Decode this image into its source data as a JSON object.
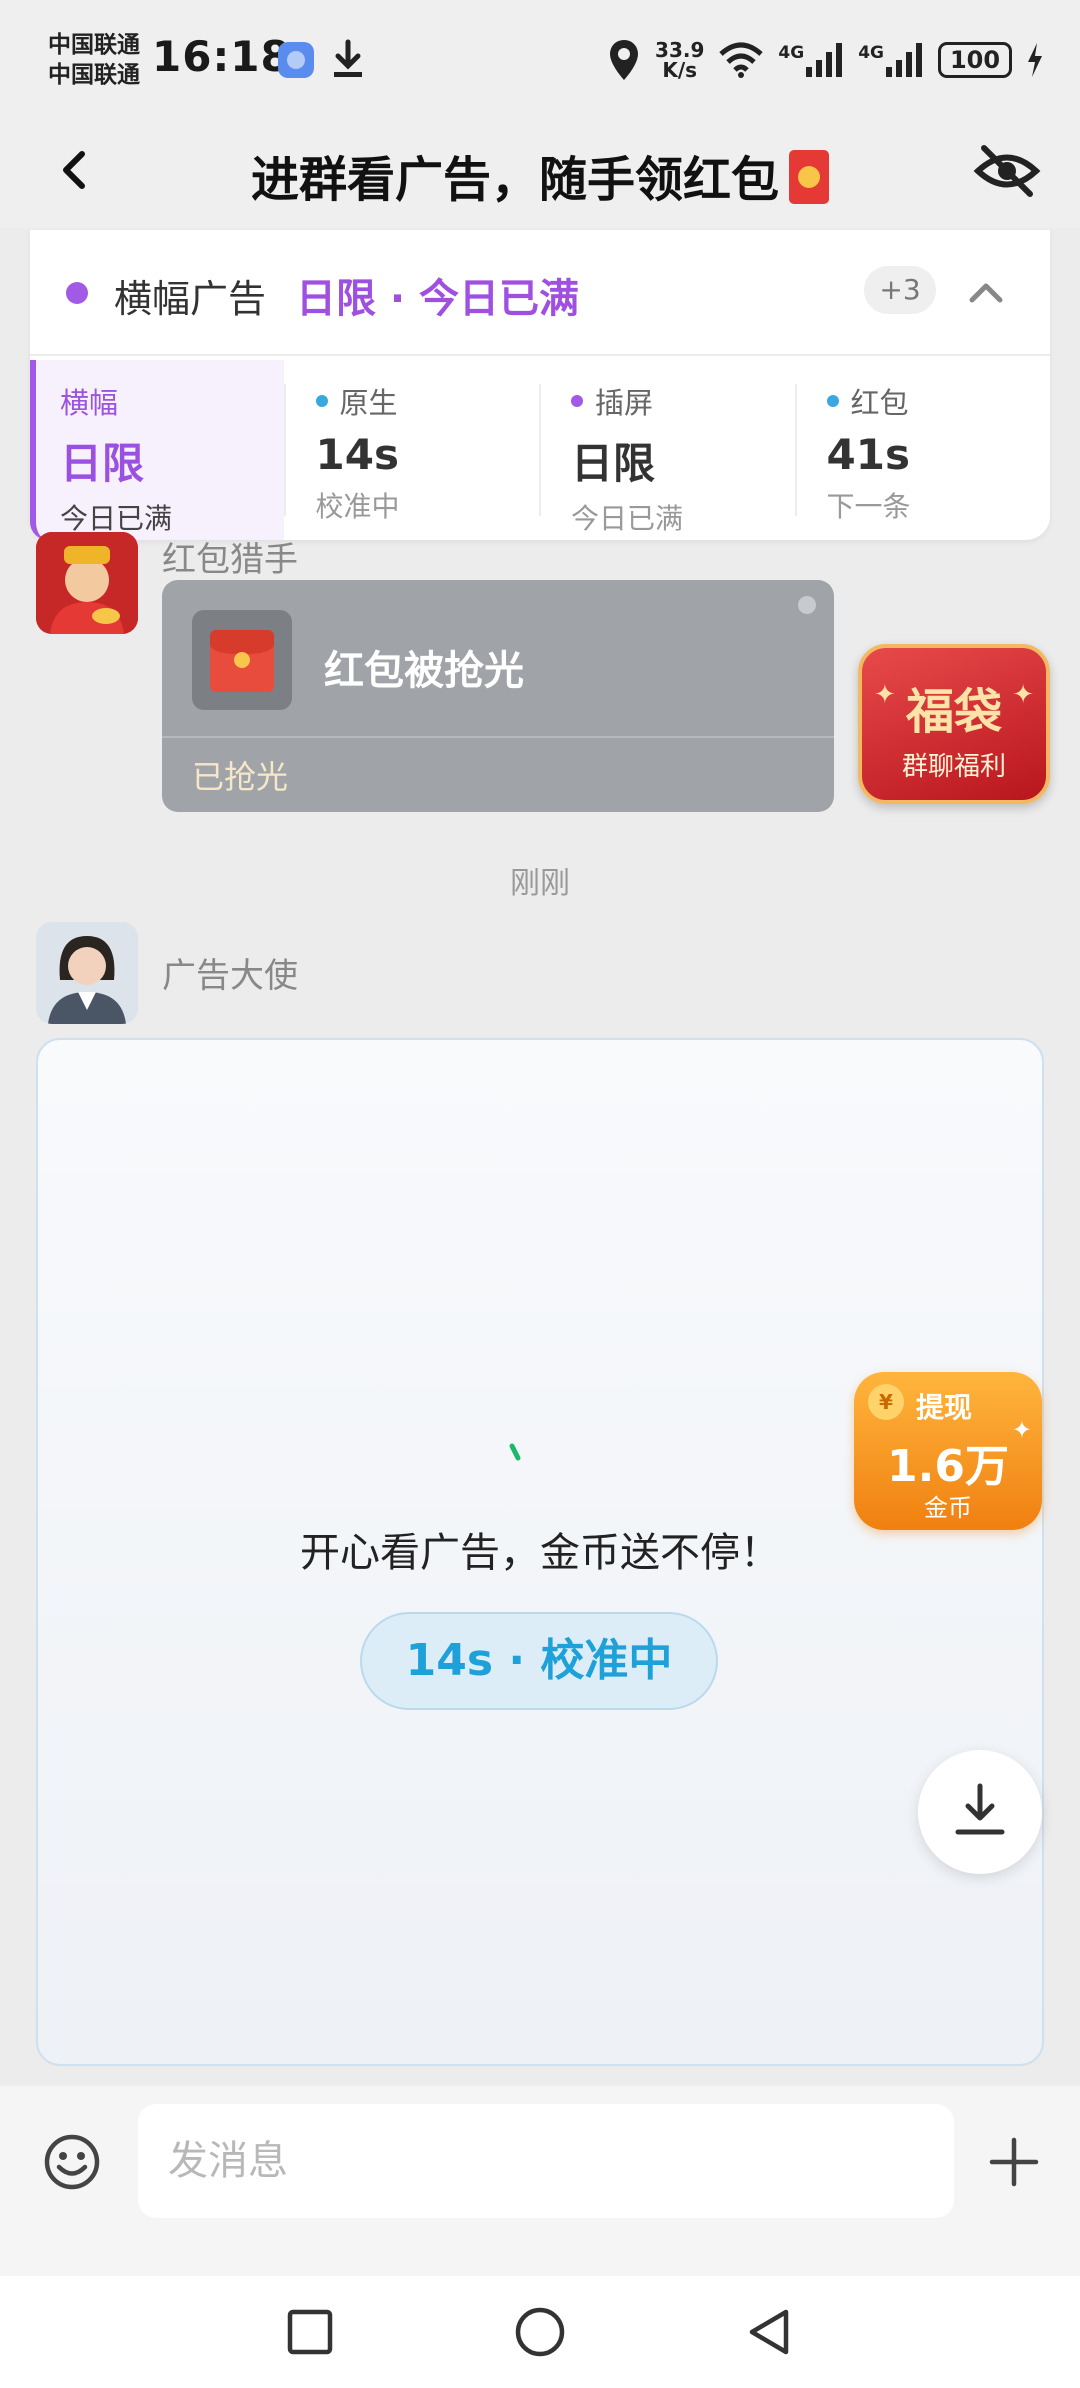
{
  "status_bar": {
    "carrier_1": "中国联通",
    "carrier_2": "中国联通",
    "time": "16:18",
    "speed_value": "33.9",
    "speed_unit": "K/s",
    "network_1": "4G",
    "network_2": "4G",
    "battery": "100"
  },
  "header": {
    "title": "进群看广告，随手领红包"
  },
  "ad_banner": {
    "name": "横幅广告",
    "status": "日限 · 今日已满",
    "more_count": "+3",
    "columns": [
      {
        "label": "横幅",
        "value": "日限",
        "sub": "今日已满",
        "dot_color": "#a25ae6"
      },
      {
        "label": "原生",
        "value": "14s",
        "sub": "校准中",
        "dot_color": "#3aa8e0"
      },
      {
        "label": "插屏",
        "value": "日限",
        "sub": "今日已满",
        "dot_color": "#a25ae6"
      },
      {
        "label": "红包",
        "value": "41s",
        "sub": "下一条",
        "dot_color": "#3aa8e0"
      }
    ]
  },
  "chat": {
    "msg1": {
      "sender": "红包猎手",
      "title": "红包被抢光",
      "footer": "已抢光"
    },
    "time_separator": "刚刚",
    "msg2": {
      "sender": "广告大使",
      "slogan": "开心看广告，金币送不停！",
      "timer": "14s · 校准中"
    }
  },
  "fudai": {
    "title": "福袋",
    "subtitle": "群聊福利"
  },
  "cash_badge": {
    "coin": "¥",
    "label": "提现",
    "amount": "1.6万",
    "unit": "金币"
  },
  "input": {
    "placeholder": "发消息"
  },
  "colors": {
    "accent_purple": "#a25ae6",
    "accent_blue": "#1ea0d8",
    "red_packet": "#e53935"
  }
}
